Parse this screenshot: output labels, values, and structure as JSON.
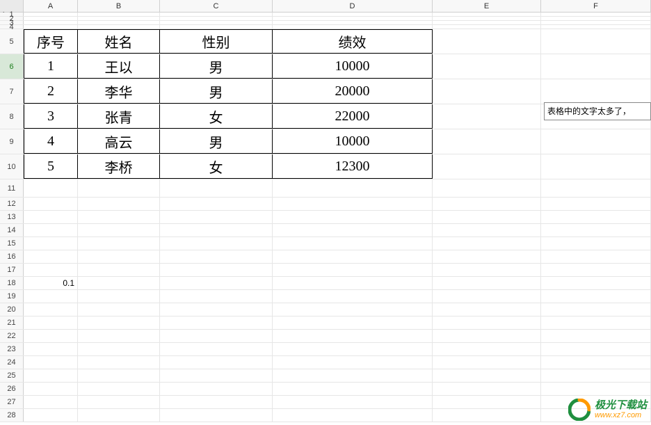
{
  "columns": [
    "A",
    "B",
    "C",
    "D",
    "E",
    "F"
  ],
  "outline": {
    "levels": [
      "1",
      "2"
    ],
    "expand": "+",
    "boundary_row": "4"
  },
  "row_numbers": [
    "1",
    "2",
    "3",
    "4",
    "5",
    "6",
    "7",
    "8",
    "9",
    "10",
    "11",
    "12",
    "13",
    "14",
    "15",
    "16",
    "17",
    "18",
    "19",
    "20",
    "21",
    "22",
    "23",
    "24",
    "25",
    "26",
    "27",
    "28"
  ],
  "active_row": "6",
  "table": {
    "headers": {
      "seq": "序号",
      "name": "姓名",
      "gender": "性别",
      "perf": "绩效"
    },
    "rows": [
      {
        "seq": "1",
        "name": "王以",
        "gender": "男",
        "perf": "10000"
      },
      {
        "seq": "2",
        "name": "李华",
        "gender": "男",
        "perf": "20000"
      },
      {
        "seq": "3",
        "name": "张青",
        "gender": "女",
        "perf": "22000"
      },
      {
        "seq": "4",
        "name": "高云",
        "gender": "男",
        "perf": "10000"
      },
      {
        "seq": "5",
        "name": "李桥",
        "gender": "女",
        "perf": "12300"
      }
    ]
  },
  "stray": {
    "a18": "0.1"
  },
  "floating_note": "表格中的文字太多了，",
  "watermark": {
    "cn": "极光下载站",
    "url": "www.xz7.com"
  }
}
